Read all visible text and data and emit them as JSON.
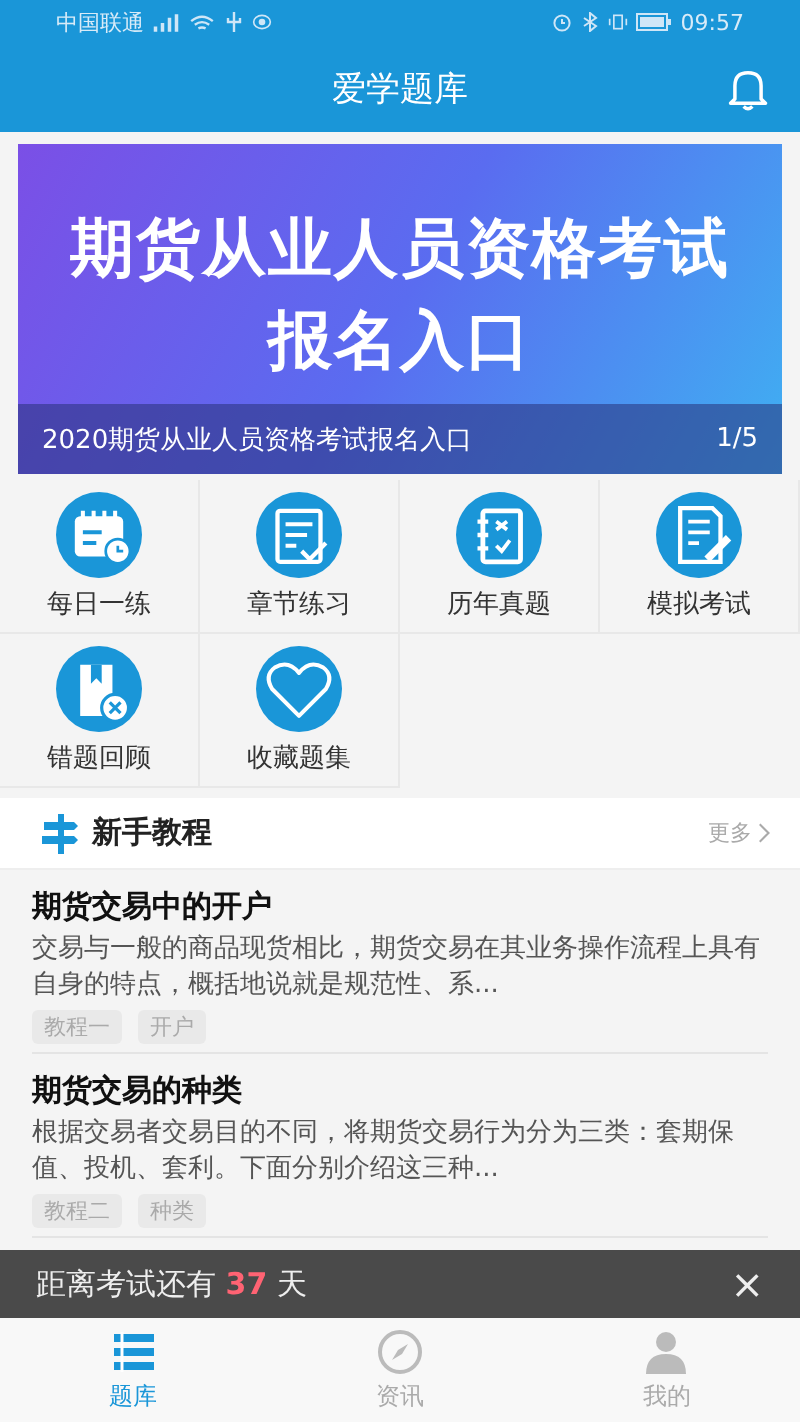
{
  "status_bar": {
    "carrier": "中国联通",
    "time": "09:57"
  },
  "app_bar": {
    "title": "爱学题库"
  },
  "banner": {
    "headline": [
      "期货从业人员资格考试",
      "报名入口"
    ],
    "caption": "2020期货从业人员资格考试报名入口",
    "counter": "1/5"
  },
  "shortcuts": [
    {
      "label": "每日一练",
      "kind": "calendar"
    },
    {
      "label": "章节练习",
      "kind": "checklist"
    },
    {
      "label": "历年真题",
      "kind": "notebook"
    },
    {
      "label": "模拟考试",
      "kind": "edit"
    },
    {
      "label": "错题回顾",
      "kind": "wrong"
    },
    {
      "label": "收藏题集",
      "kind": "heart"
    }
  ],
  "section": {
    "title": "新手教程",
    "more": "更多"
  },
  "articles": [
    {
      "title": "期货交易中的开户",
      "summary": "交易与一般的商品现货相比，期货交易在其业务操作流程上具有自身的特点，概括地说就是规范性、系...",
      "tags": [
        "教程一",
        "开户"
      ]
    },
    {
      "title": "期货交易的种类",
      "summary": "根据交易者交易目的不同，将期货交易行为分为三类：套期保值、投机、套利。下面分别介绍这三种...",
      "tags": [
        "教程二",
        "种类"
      ]
    }
  ],
  "countdown": {
    "prefix": "距离考试还有",
    "days": "37",
    "suffix": "天",
    "close": "×"
  },
  "tabs": [
    {
      "label": "题库",
      "kind": "list",
      "selected": true
    },
    {
      "label": "资讯",
      "kind": "compass",
      "selected": false
    },
    {
      "label": "我的",
      "kind": "person",
      "selected": false
    }
  ]
}
